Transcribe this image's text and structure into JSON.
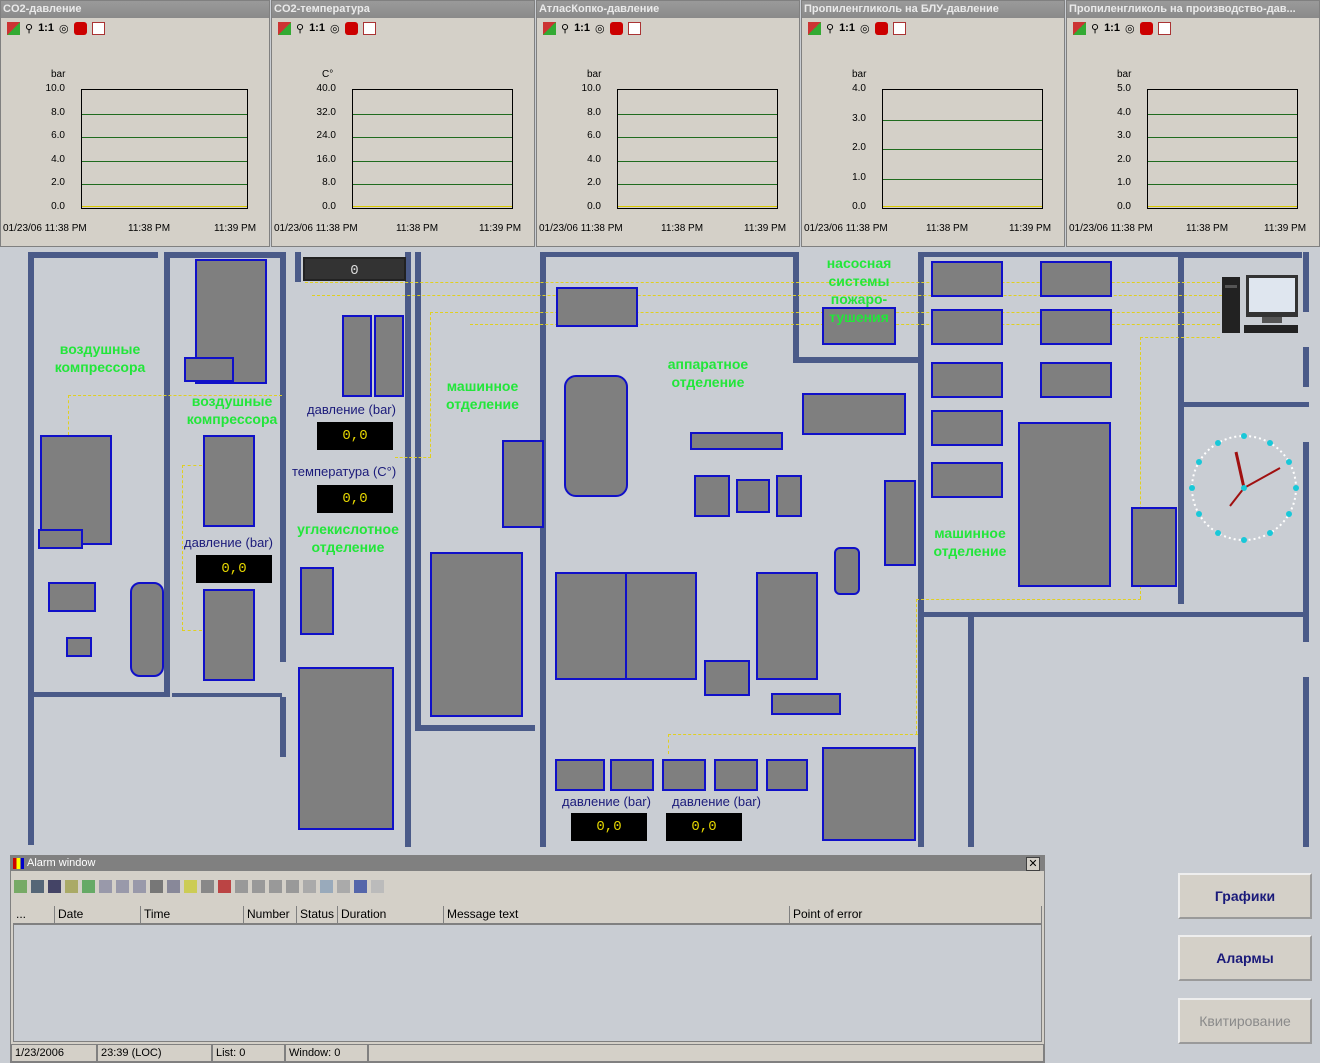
{
  "trends": [
    {
      "title": "CO2-давление",
      "unit": "bar",
      "yticks": [
        "10.0",
        "8.0",
        "6.0",
        "4.0",
        "2.0",
        "0.0"
      ]
    },
    {
      "title": "CO2-температура",
      "unit": "C°",
      "yticks": [
        "40.0",
        "32.0",
        "24.0",
        "16.0",
        "8.0",
        "0.0"
      ]
    },
    {
      "title": "АтласКопко-давление",
      "unit": "bar",
      "yticks": [
        "10.0",
        "8.0",
        "6.0",
        "4.0",
        "2.0",
        "0.0"
      ]
    },
    {
      "title": "Пропиленгликоль на БЛУ-давление",
      "unit": "bar",
      "yticks": [
        "4.0",
        "3.0",
        "2.0",
        "1.0",
        "0.0"
      ]
    },
    {
      "title": "Пропиленгликоль на производство-дав...",
      "unit": "bar",
      "yticks": [
        "5.0",
        "4.0",
        "3.0",
        "2.0",
        "1.0",
        "0.0"
      ]
    }
  ],
  "trend_toolbar": {
    "scale_label": "1:1"
  },
  "trend_time": {
    "t1": "01/23/06 11:38 PM",
    "t2": "11:38 PM",
    "t3": "11:39 PM"
  },
  "plan": {
    "air_comp_1": "воздушные компрессора",
    "air_comp_2": "воздушные компрессора",
    "machine_1": "машинное отделение",
    "apparatus": "аппаратное отделение",
    "pump": "насосная системы пожаро-тушения",
    "machine_2": "машинное отделение",
    "co2_dept": "углекислотное отделение",
    "pressure_bar": "давление (bar)",
    "temperature": "температура (С°)",
    "value": "0,0",
    "top_display": "0"
  },
  "alarm": {
    "title": "Alarm window",
    "columns": [
      "...",
      "Date",
      "Time",
      "Number",
      "Status",
      "Duration",
      "Message text",
      "Point of error"
    ],
    "status": {
      "date": "1/23/2006",
      "time": "23:39 (LOC)",
      "list": "List: 0",
      "window": "Window: 0"
    }
  },
  "buttons": {
    "graphs": "Графики",
    "alarms": "Алармы",
    "ack": "Квитирование"
  }
}
